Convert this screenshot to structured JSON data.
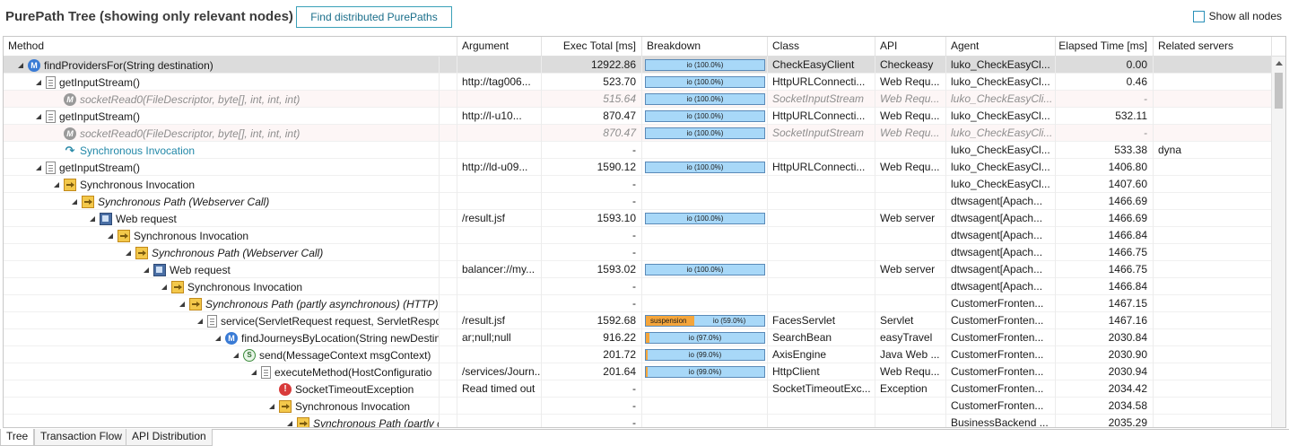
{
  "header": {
    "title": "PurePath Tree (showing only relevant nodes)",
    "find_button": "Find distributed PurePaths",
    "show_all_label": "Show all nodes"
  },
  "columns": [
    "Method",
    "Argument",
    "Exec Total [ms]",
    "Breakdown",
    "Class",
    "API",
    "Agent",
    "Elapsed Time [ms]",
    "Related servers"
  ],
  "rows": [
    {
      "indent": 0,
      "icon": "method-icon",
      "method": "findProvidersFor(String destination)",
      "argument": "",
      "exec": "12922.86",
      "bar": "io (100.0%)",
      "class": "CheckEasyClient",
      "api": "Checkeasy",
      "agent": "luko_CheckEasyCl...",
      "elapsed": "0.00",
      "related": "",
      "selected": true,
      "expanded": true
    },
    {
      "indent": 1,
      "icon": "page-icon",
      "method": "getInputStream()",
      "argument": "http://tag006...",
      "exec": "523.70",
      "bar": "io (100.0%)",
      "class": "HttpURLConnecti...",
      "api": "Web Requ...",
      "agent": "luko_CheckEasyCl...",
      "elapsed": "0.46",
      "related": "",
      "expanded": true
    },
    {
      "indent": 2,
      "icon": "method-grey-icon",
      "method": "socketRead0(FileDescriptor, byte[], int, int, int)",
      "argument": "",
      "exec": "515.64",
      "bar": "io (100.0%)",
      "class": "SocketInputStream",
      "api": "Web Requ...",
      "agent": "luko_CheckEasyCli...",
      "elapsed": "-",
      "related": "",
      "faded": true
    },
    {
      "indent": 1,
      "icon": "page-icon",
      "method": "getInputStream()",
      "argument": "http://l-u10...",
      "exec": "870.47",
      "bar": "io (100.0%)",
      "class": "HttpURLConnecti...",
      "api": "Web Requ...",
      "agent": "luko_CheckEasyCl...",
      "elapsed": "532.11",
      "related": "",
      "expanded": true
    },
    {
      "indent": 2,
      "icon": "method-grey-icon",
      "method": "socketRead0(FileDescriptor, byte[], int, int, int)",
      "argument": "",
      "exec": "870.47",
      "bar": "io (100.0%)",
      "class": "SocketInputStream",
      "api": "Web Requ...",
      "agent": "luko_CheckEasyCli...",
      "elapsed": "-",
      "related": "",
      "faded": true
    },
    {
      "indent": 2,
      "icon": "invoke-icon",
      "method": "Synchronous Invocation",
      "argument": "",
      "exec": "-",
      "bar": "",
      "class": "",
      "api": "",
      "agent": "luko_CheckEasyCl...",
      "elapsed": "533.38",
      "related": "dyna",
      "link": true
    },
    {
      "indent": 1,
      "icon": "page-icon",
      "method": "getInputStream()",
      "argument": "http://ld-u09...",
      "exec": "1590.12",
      "bar": "io (100.0%)",
      "class": "HttpURLConnecti...",
      "api": "Web Requ...",
      "agent": "luko_CheckEasyCl...",
      "elapsed": "1406.80",
      "related": "",
      "expanded": true
    },
    {
      "indent": 2,
      "icon": "sync-icon",
      "method": "Synchronous Invocation",
      "argument": "",
      "exec": "-",
      "bar": "",
      "class": "",
      "api": "",
      "agent": "luko_CheckEasyCl...",
      "elapsed": "1407.60",
      "related": "",
      "expanded": true
    },
    {
      "indent": 3,
      "icon": "sync-icon",
      "method": "Synchronous Path (Webserver Call)",
      "argument": "",
      "exec": "-",
      "bar": "",
      "class": "",
      "api": "",
      "agent": "dtwsagent[Apach...",
      "elapsed": "1466.69",
      "related": "",
      "italic": true,
      "expanded": true
    },
    {
      "indent": 4,
      "icon": "web-icon",
      "method": "Web request",
      "argument": "/result.jsf",
      "exec": "1593.10",
      "bar": "io (100.0%)",
      "class": "",
      "api": "Web server",
      "agent": "dtwsagent[Apach...",
      "elapsed": "1466.69",
      "related": "",
      "expanded": true
    },
    {
      "indent": 5,
      "icon": "sync-icon",
      "method": "Synchronous Invocation",
      "argument": "",
      "exec": "-",
      "bar": "",
      "class": "",
      "api": "",
      "agent": "dtwsagent[Apach...",
      "elapsed": "1466.84",
      "related": "",
      "expanded": true
    },
    {
      "indent": 6,
      "icon": "sync-icon",
      "method": "Synchronous Path (Webserver Call)",
      "argument": "",
      "exec": "-",
      "bar": "",
      "class": "",
      "api": "",
      "agent": "dtwsagent[Apach...",
      "elapsed": "1466.75",
      "related": "",
      "italic": true,
      "expanded": true
    },
    {
      "indent": 7,
      "icon": "web-icon",
      "method": "Web request",
      "argument": "balancer://my...",
      "exec": "1593.02",
      "bar": "io (100.0%)",
      "class": "",
      "api": "Web server",
      "agent": "dtwsagent[Apach...",
      "elapsed": "1466.75",
      "related": "",
      "expanded": true
    },
    {
      "indent": 8,
      "icon": "sync-icon",
      "method": "Synchronous Invocation",
      "argument": "",
      "exec": "-",
      "bar": "",
      "class": "",
      "api": "",
      "agent": "dtwsagent[Apach...",
      "elapsed": "1466.84",
      "related": "",
      "expanded": true
    },
    {
      "indent": 9,
      "icon": "sync-icon",
      "method": "Synchronous Path (partly asynchronous) (HTTP)",
      "argument": "",
      "exec": "-",
      "bar": "",
      "class": "",
      "api": "",
      "agent": "CustomerFronten...",
      "elapsed": "1467.15",
      "related": "",
      "italic": true,
      "expanded": true
    },
    {
      "indent": 10,
      "icon": "page-icon",
      "method": "service(ServletRequest request, ServletRespon",
      "argument": "/result.jsf",
      "exec": "1592.68",
      "bar": "io (59.0%)",
      "bar_susp": "suspension",
      "susp_frac": 0.41,
      "class": "FacesServlet",
      "api": "Servlet",
      "agent": "CustomerFronten...",
      "elapsed": "1467.16",
      "related": "",
      "expanded": true
    },
    {
      "indent": 11,
      "icon": "method-icon",
      "method": "findJourneysByLocation(String newDestin",
      "argument": "ar;null;null",
      "exec": "916.22",
      "bar": "io (97.0%)",
      "slice_frac": 0.03,
      "class": "SearchBean",
      "api": "easyTravel",
      "agent": "CustomerFronten...",
      "elapsed": "2030.84",
      "related": "",
      "expanded": true
    },
    {
      "indent": 12,
      "icon": "send-icon",
      "method": "send(MessageContext msgContext)",
      "argument": "",
      "exec": "201.72",
      "bar": "io (99.0%)",
      "slice_frac": 0.01,
      "class": "AxisEngine",
      "api": "Java Web ...",
      "agent": "CustomerFronten...",
      "elapsed": "2030.90",
      "related": "",
      "expanded": true
    },
    {
      "indent": 13,
      "icon": "page-icon",
      "method": "executeMethod(HostConfiguratio",
      "argument": "/services/Journ...",
      "exec": "201.64",
      "bar": "io (99.0%)",
      "slice_frac": 0.01,
      "class": "HttpClient",
      "api": "Web Requ...",
      "agent": "CustomerFronten...",
      "elapsed": "2030.94",
      "related": "",
      "expanded": true
    },
    {
      "indent": 14,
      "icon": "exception-icon",
      "method": "SocketTimeoutException",
      "argument": "Read timed out",
      "exec": "-",
      "bar": "",
      "class": "SocketTimeoutExc...",
      "api": "Exception",
      "agent": "CustomerFronten...",
      "elapsed": "2034.42",
      "related": "",
      "leaf": true
    },
    {
      "indent": 14,
      "icon": "sync-icon",
      "method": "Synchronous Invocation",
      "argument": "",
      "exec": "-",
      "bar": "",
      "class": "",
      "api": "",
      "agent": "CustomerFronten...",
      "elapsed": "2034.58",
      "related": "",
      "expanded": true
    },
    {
      "indent": 15,
      "icon": "sync-icon",
      "method": "Synchronous Path (partly c",
      "argument": "",
      "exec": "-",
      "bar": "",
      "class": "",
      "api": "",
      "agent": "BusinessBackend ...",
      "elapsed": "2035.29",
      "related": "",
      "italic": true,
      "expanded": true
    }
  ],
  "tabs": [
    "Tree",
    "Transaction Flow",
    "API Distribution"
  ],
  "colors": {
    "accent": "#2288a8",
    "bar_io": "#a8d8f8",
    "bar_suspension": "#f5a53a",
    "selected_row": "#dcdcdc"
  }
}
